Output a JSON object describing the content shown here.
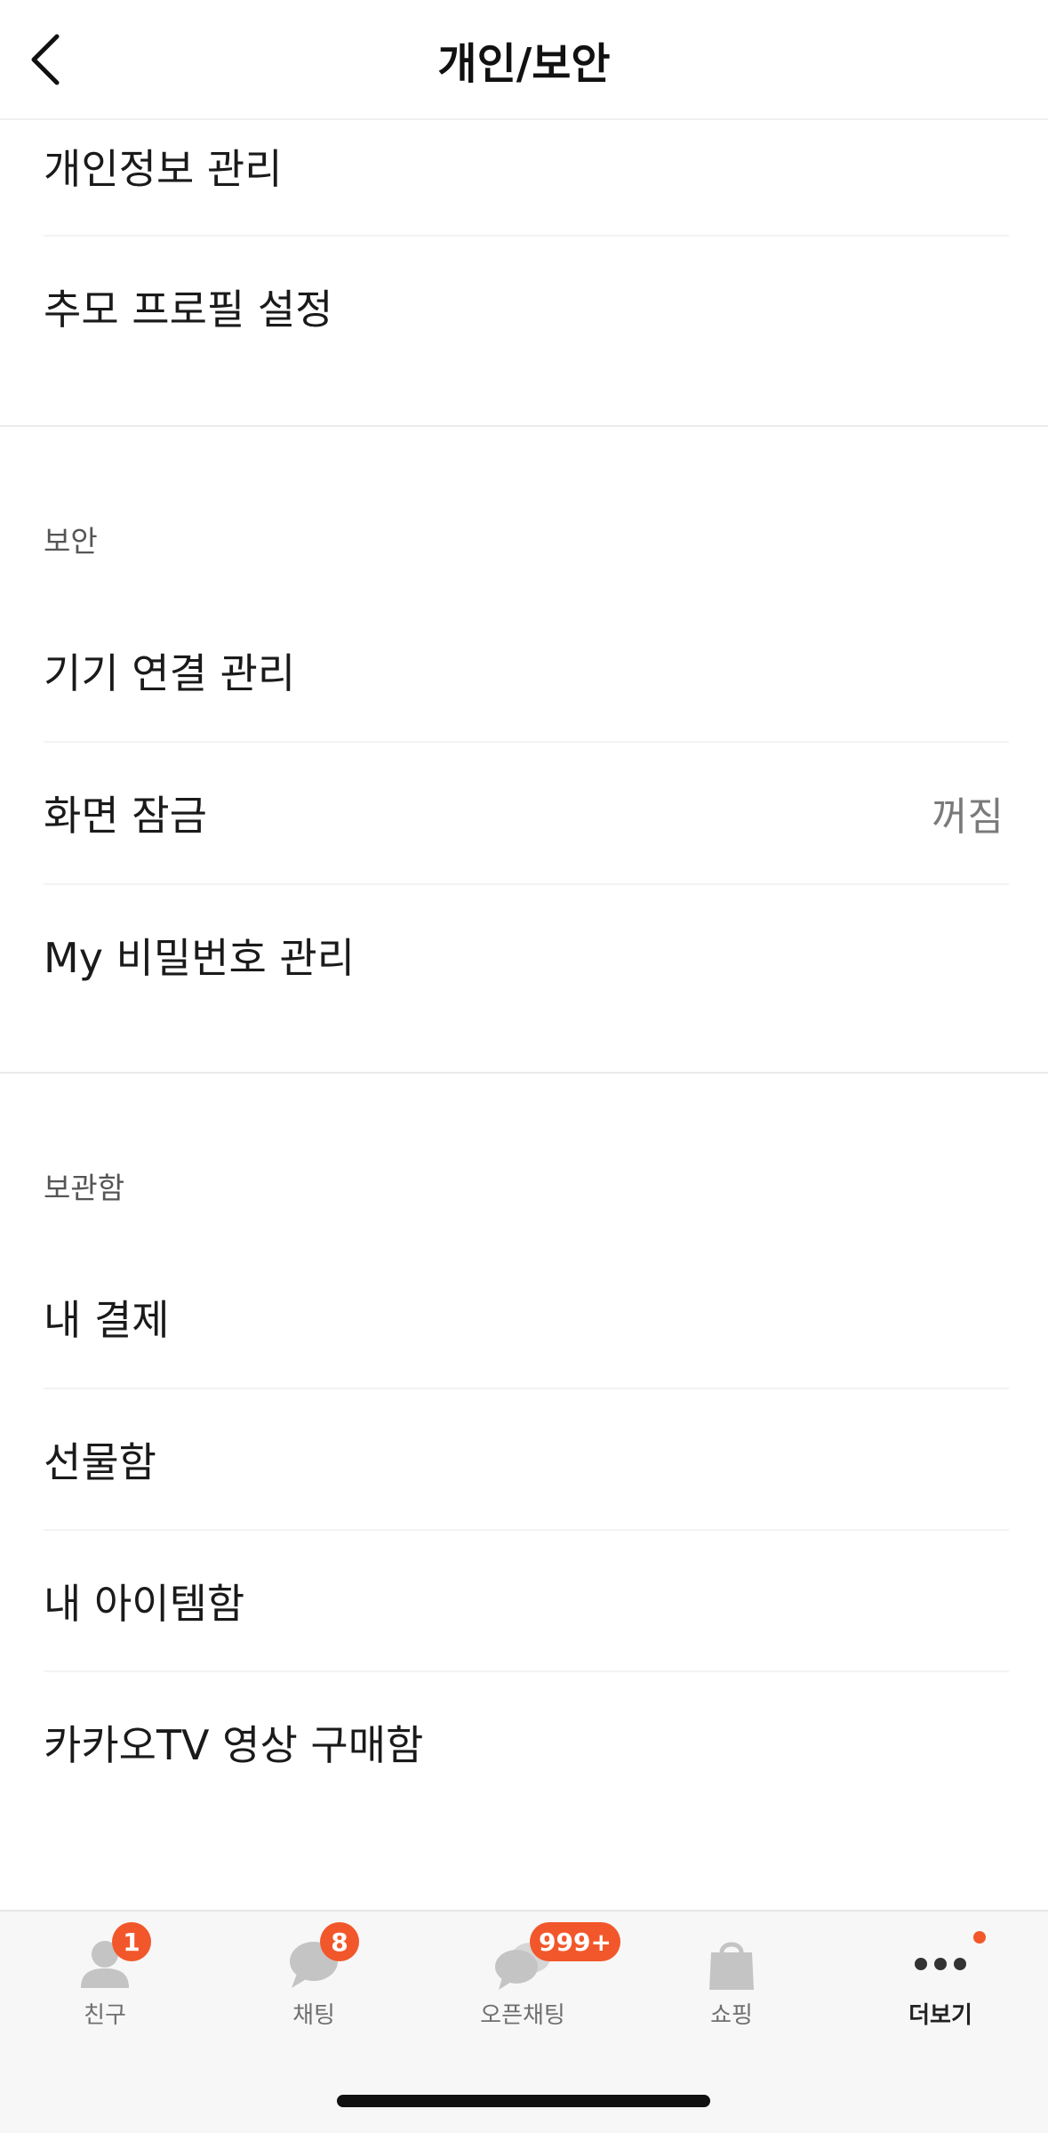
{
  "header": {
    "title": "개인/보안"
  },
  "top_section": {
    "items": [
      {
        "label": "개인정보 관리"
      },
      {
        "label": "추모 프로필 설정"
      }
    ]
  },
  "security_section": {
    "title": "보안",
    "items": [
      {
        "label": "기기 연결 관리",
        "value": ""
      },
      {
        "label": "화면 잠금",
        "value": "꺼짐"
      },
      {
        "label": "My 비밀번호 관리",
        "value": ""
      }
    ]
  },
  "storage_section": {
    "title": "보관함",
    "items": [
      {
        "label": "내 결제"
      },
      {
        "label": "선물함"
      },
      {
        "label": "내 아이템함"
      },
      {
        "label": "카카오TV 영상 구매함"
      }
    ]
  },
  "tabbar": {
    "tabs": [
      {
        "label": "친구",
        "badge": "1",
        "icon": "person-icon"
      },
      {
        "label": "채팅",
        "badge": "8",
        "icon": "chat-bubble-icon"
      },
      {
        "label": "오픈채팅",
        "badge": "999+",
        "icon": "open-chat-icon"
      },
      {
        "label": "쇼핑",
        "badge": "",
        "icon": "shopping-bag-icon"
      },
      {
        "label": "더보기",
        "badge": "",
        "icon": "more-dots-icon"
      }
    ]
  },
  "colors": {
    "badge": "#f2572b",
    "icon_gray": "#c4c4c4",
    "active_icon": "#333333"
  }
}
